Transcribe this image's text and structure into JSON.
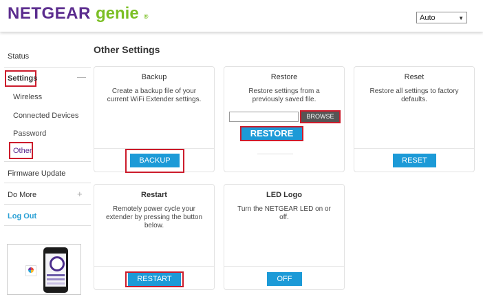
{
  "header": {
    "brand": "NETGEAR",
    "genie": "genie",
    "reg": "®",
    "language_value": "Auto"
  },
  "sidebar": {
    "status": "Status",
    "settings": "Settings",
    "settings_toggle": "—",
    "wireless": "Wireless",
    "connected_devices": "Connected Devices",
    "password": "Password",
    "other": "Other",
    "firmware_update": "Firmware Update",
    "do_more": "Do More",
    "do_more_toggle": "+",
    "log_out": "Log Out"
  },
  "main": {
    "title": "Other Settings",
    "backup": {
      "title": "Backup",
      "desc": "Create a backup file of your current WiFi Extender settings.",
      "button": "BACKUP"
    },
    "restore": {
      "title": "Restore",
      "desc": "Restore settings from a previously saved file.",
      "browse": "BROWSE",
      "button": "RESTORE"
    },
    "reset": {
      "title": "Reset",
      "desc": "Restore all settings to factory defaults.",
      "button": "RESET"
    },
    "restart": {
      "title": "Restart",
      "desc": "Remotely power cycle your extender by pressing the button below.",
      "button": "RESTART"
    },
    "led_logo": {
      "title": "LED Logo",
      "desc": "Turn the NETGEAR LED on or off.",
      "button": "OFF"
    }
  },
  "colors": {
    "brand_purple": "#5b2c8e",
    "genie_green": "#7bbf24",
    "button_blue": "#1c9ad7",
    "highlight_red": "#cc1b2b",
    "logout_blue": "#2aa0d5"
  }
}
